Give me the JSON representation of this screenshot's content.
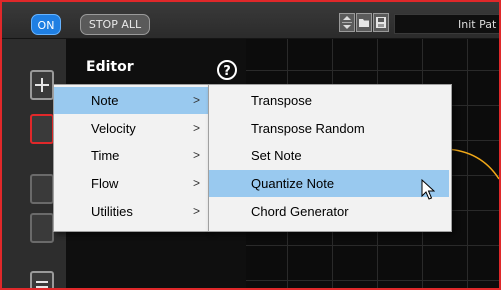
{
  "toolbar": {
    "on_label": "ON",
    "stop_label": "STOP ALL",
    "preset_name": "Init Pat"
  },
  "editor": {
    "title": "Editor",
    "help_label": "?"
  },
  "menu": {
    "items": [
      {
        "label": "Note",
        "arrow": ">"
      },
      {
        "label": "Velocity",
        "arrow": ">"
      },
      {
        "label": "Time",
        "arrow": ">"
      },
      {
        "label": "Flow",
        "arrow": ">"
      },
      {
        "label": "Utilities",
        "arrow": ">"
      }
    ],
    "selected": "Note"
  },
  "submenu": {
    "items": [
      {
        "label": "Transpose"
      },
      {
        "label": "Transpose Random"
      },
      {
        "label": "Set Note"
      },
      {
        "label": "Quantize Note"
      },
      {
        "label": "Chord Generator"
      }
    ],
    "highlighted": "Quantize Note"
  },
  "colors": {
    "accent_blue": "#1f7fe3",
    "frame_red": "#e0282a",
    "highlight": "#99c9ef",
    "curve": "#f0a818"
  }
}
